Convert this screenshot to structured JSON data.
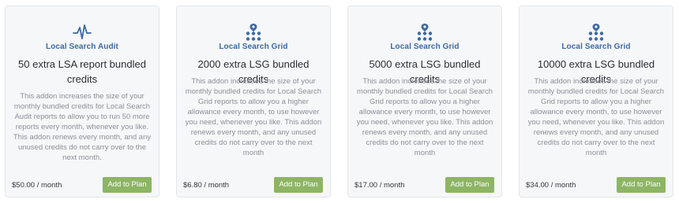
{
  "cards": [
    {
      "icon": "pulse-icon",
      "product": "Local Search Audit",
      "title": "50 extra LSA report bundled credits",
      "description": "This addon increases the size of your monthly bundled credits for Local Search Audit reports to allow you to run 50 more reports every month, whenever you like. This addon renews every month, and any unused credits do not carry over to the next month.",
      "price": "$50.00 / month",
      "button": "Add to Plan"
    },
    {
      "icon": "grid-pin-icon",
      "product": "Local Search Grid",
      "title": "2000 extra LSG bundled credits",
      "description": "This addon increases the size of your monthly bundled credits for Local Search Grid reports to allow you a higher allowance every month, to use however you need, whenever you like. This addon renews every month, and any unused credits do not carry over to the next month",
      "price": "$6.80 / month",
      "button": "Add to Plan"
    },
    {
      "icon": "grid-pin-icon",
      "product": "Local Search Grid",
      "title": "5000 extra LSG bundled credits",
      "description": "This addon increases the size of your monthly bundled credits for Local Search Grid reports to allow you a higher allowance every month, to use however you need, whenever you like. This addon renews every month, and any unused credits do not carry over to the next month",
      "price": "$17.00 / month",
      "button": "Add to Plan"
    },
    {
      "icon": "grid-pin-icon",
      "product": "Local Search Grid",
      "title": "10000 extra LSG bundled credits",
      "description": "This addon increases the size of your monthly bundled credits for Local Search Grid reports to allow you a higher allowance every month, to use however you need, whenever you like. This addon renews every month, and any unused credits do not carry over to the next month",
      "price": "$34.00 / month",
      "button": "Add to Plan"
    }
  ],
  "colors": {
    "accent": "#3c6aa3",
    "button": "#8db564"
  }
}
